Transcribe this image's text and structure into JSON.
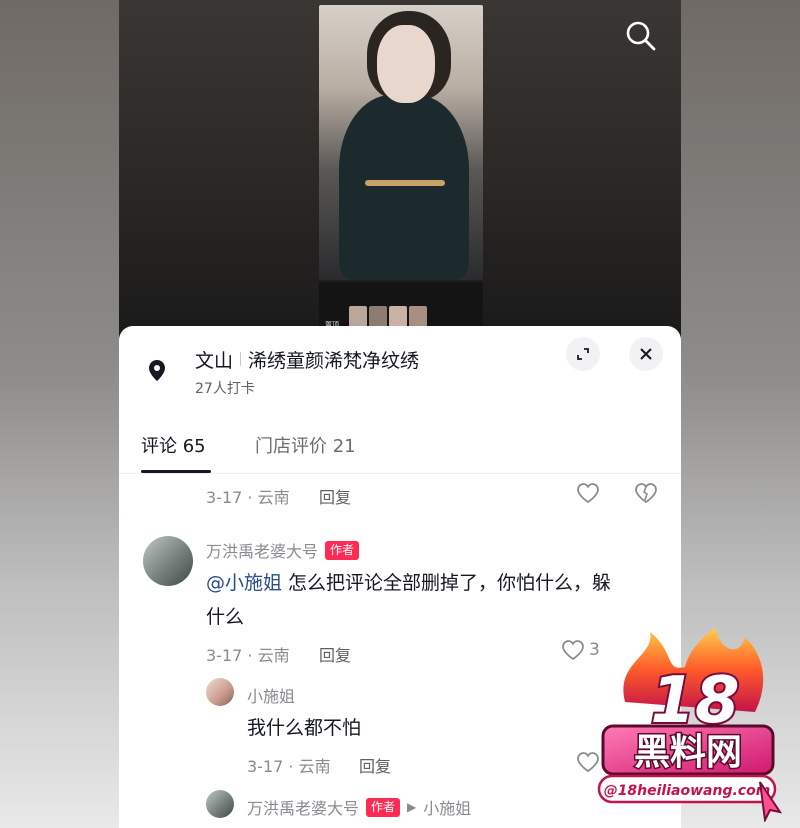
{
  "sheet": {
    "place_city": "文山",
    "place_name": "浠绣童颜浠梵净纹绣",
    "checkins": "27人打卡"
  },
  "tabs": [
    {
      "label": "评论 65",
      "active": true
    },
    {
      "label": "门店评价 21",
      "active": false
    }
  ],
  "comments": [
    {
      "meta": "3-17 · 云南",
      "reply": "回复"
    },
    {
      "user": "万洪禹老婆大号",
      "badge": "作者",
      "mention": "@小施姐",
      "text_line1": " 怎么把评论全部删掉了，你怕什么，躲",
      "text_line2": "什么",
      "meta": "3-17 · 云南",
      "reply": "回复",
      "likes": "3"
    },
    {
      "user": "小施姐",
      "text": "我什么都不怕",
      "meta": "3-17 · 云南",
      "reply": "回复"
    },
    {
      "user": "万洪禹老婆大号",
      "badge": "作者",
      "reply_to": "小施姐"
    }
  ],
  "video": {
    "strip_label": "置顶"
  },
  "watermark": {
    "big": "18",
    "text": "黑料网",
    "url": "@18heiliaowang.com"
  },
  "colors": {
    "accent": "#fe2c55",
    "mention": "#2a4c8c"
  }
}
